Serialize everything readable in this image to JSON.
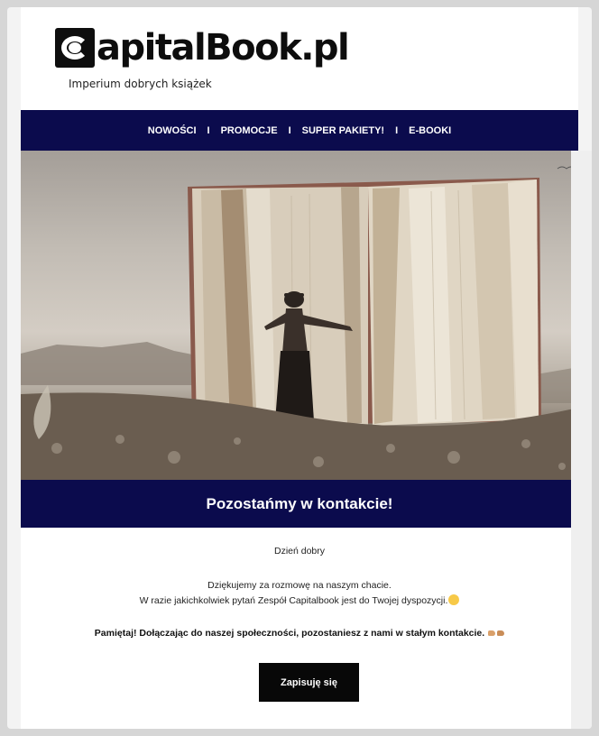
{
  "brand": {
    "logo_text": "apitalBook.pl",
    "tagline": "Imperium dobrych książek"
  },
  "nav": {
    "items": [
      "NOWOŚCI",
      "PROMOCJE",
      "SUPER PAKIETY!",
      "E-BOOKI"
    ],
    "separator": "I"
  },
  "hero": {
    "icon": "open-book-illustration"
  },
  "banner": {
    "title": "Pozostańmy w kontakcie!"
  },
  "body": {
    "greeting": "Dzień dobry",
    "line1": "Dziękujemy za rozmowę na naszym chacie.",
    "line2": "W razie jakichkolwiek pytań Zespół Capitalbook jest do Twojej dyspozycji.",
    "line3": "Pamiętaj! Dołączając do naszej społeczności, pozostaniesz z nami w stałym kontakcie."
  },
  "cta": {
    "label": "Zapisuję się"
  },
  "colors": {
    "navy": "#0b0b4d",
    "black": "#080808"
  }
}
